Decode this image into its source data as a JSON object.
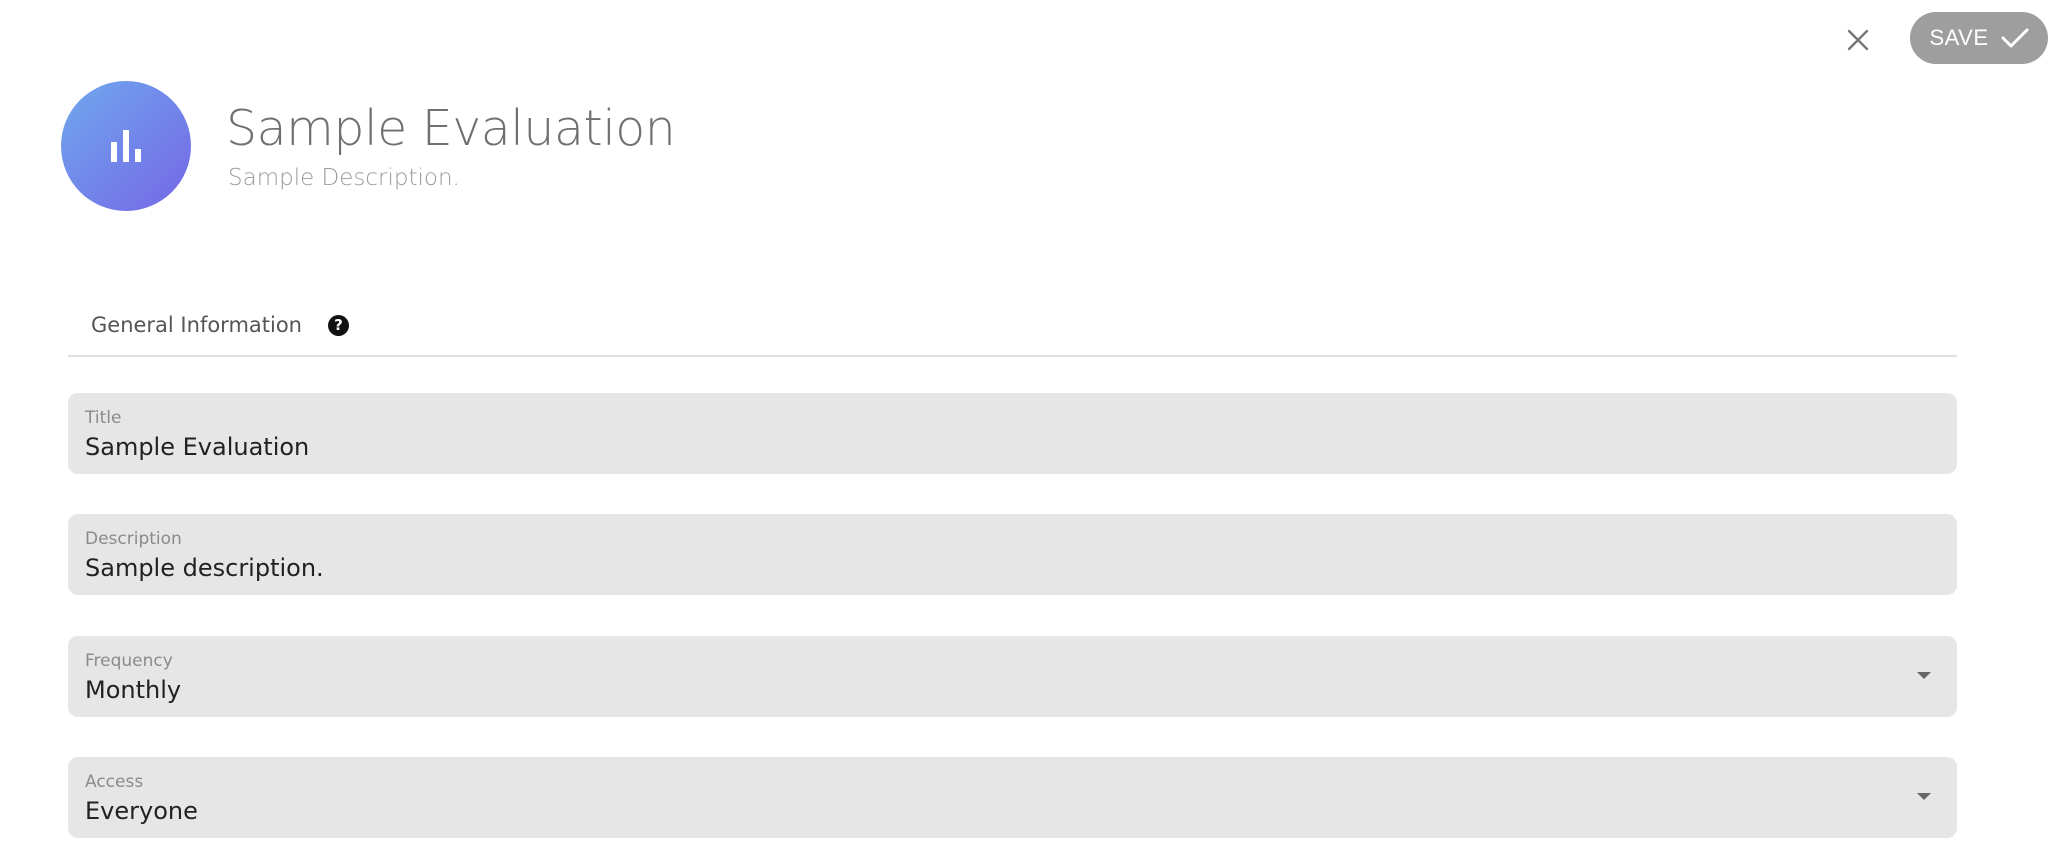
{
  "toolbar": {
    "close_icon": "close-icon",
    "save_label": "SAVE",
    "save_icon": "check-icon"
  },
  "header": {
    "avatar_icon": "bar-chart-icon",
    "title": "Sample Evaluation",
    "subtitle": "Sample Description."
  },
  "tabs": [
    {
      "label": "General Information",
      "help_icon": "help-icon"
    }
  ],
  "form": {
    "title": {
      "label": "Title",
      "value": "Sample Evaluation"
    },
    "description": {
      "label": "Description",
      "value": "Sample description."
    },
    "frequency": {
      "label": "Frequency",
      "value": "Monthly"
    },
    "access": {
      "label": "Access",
      "value": "Everyone"
    }
  },
  "colors": {
    "avatar_gradient_start": "#6fa8ee",
    "avatar_gradient_end": "#7566e6",
    "save_button": "#9e9e9e",
    "field_background": "#e6e6e6"
  }
}
